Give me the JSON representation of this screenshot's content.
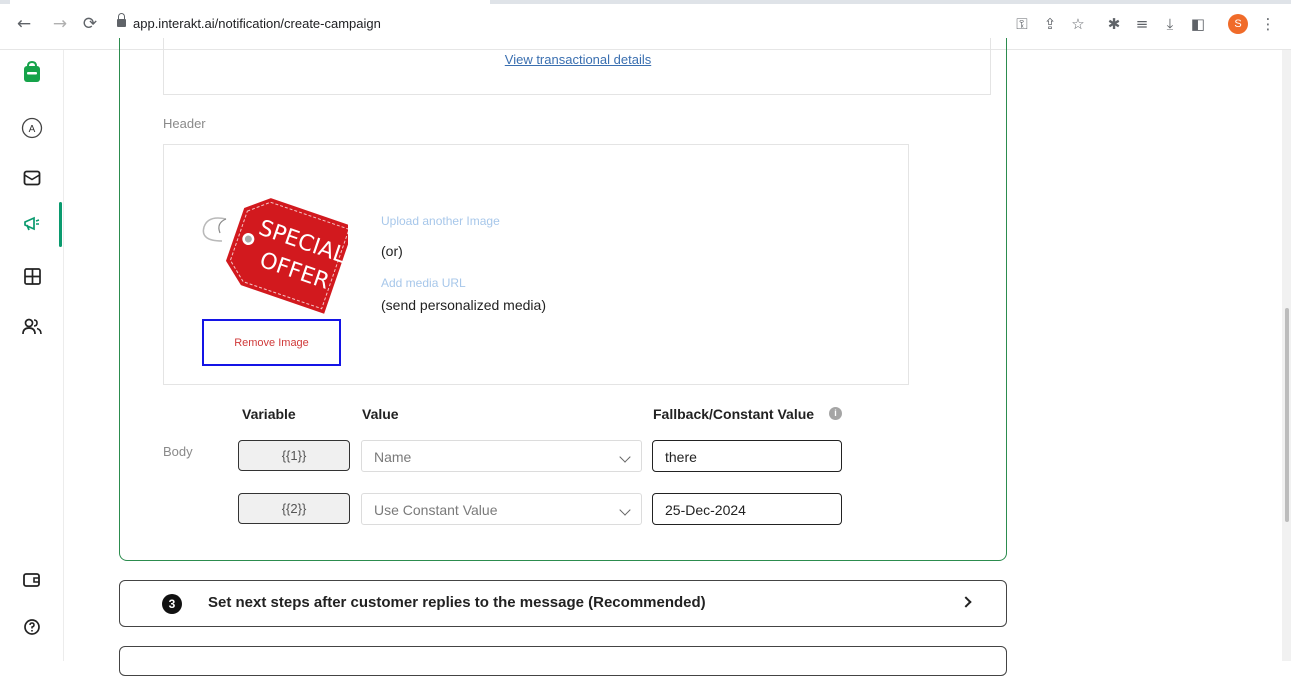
{
  "browser": {
    "url": "app.interakt.ai/notification/create-campaign",
    "profile_initial": "S"
  },
  "campaign": {
    "transactional_link": "View transactional details",
    "header_label": "Header",
    "remove_image_label": "Remove Image",
    "upload_another_label": "Upload another Image",
    "or_label": "(or)",
    "add_media_url_label": "Add media URL",
    "personalized_label": "(send personalized media)",
    "image_text": [
      "SPECIAL",
      "OFFER"
    ],
    "columns": {
      "variable": "Variable",
      "value": "Value",
      "fallback": "Fallback/Constant Value"
    },
    "body_label": "Body",
    "rows": [
      {
        "variable": "{{1}}",
        "value": "Name",
        "fallback": "there"
      },
      {
        "variable": "{{2}}",
        "value": "Use Constant Value",
        "fallback": "25-Dec-2024"
      }
    ]
  },
  "step3": {
    "number": "3",
    "title": "Set next steps after customer replies to the message (Recommended)"
  },
  "colors": {
    "accent_green": "#2c8c4e",
    "link_blue": "#3a6fb0",
    "light_link": "#a7c7ea",
    "remove_red": "#d03a3a",
    "highlight_blue": "#1414e6"
  }
}
